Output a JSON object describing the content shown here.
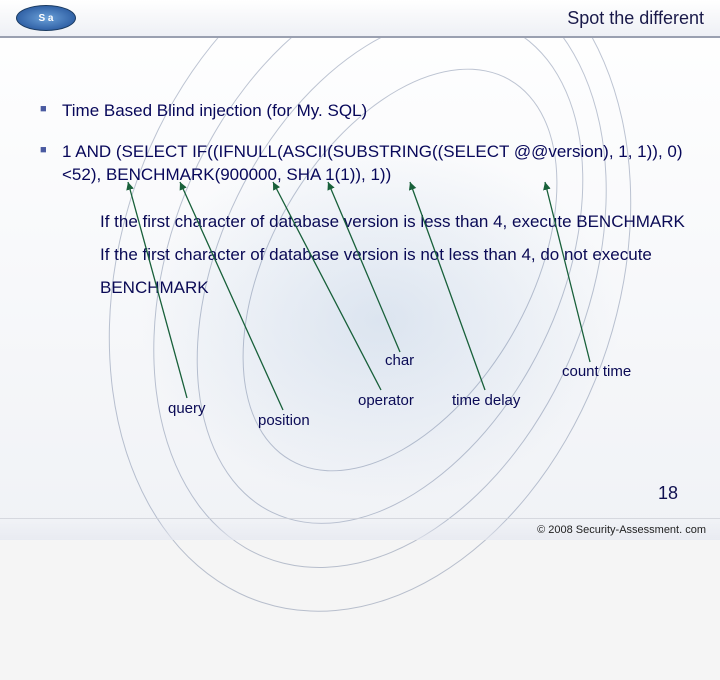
{
  "header": {
    "logo_text": "S a",
    "title": "Spot the different"
  },
  "bullets": [
    "Time Based Blind injection (for My. SQL)",
    "1 AND (SELECT IF((IFNULL(ASCII(SUBSTRING((SELECT @@version), 1, 1)), 0)<52), BENCHMARK(900000, SHA 1(1)), 1))"
  ],
  "explanation": "If the first character of database version is less than 4, execute BENCHMARK If the first character of database version is not less than 4, do not execute BENCHMARK",
  "labels": {
    "char": "char",
    "count_time": "count time",
    "query": "query",
    "position": "position",
    "operator": "operator",
    "time_delay": "time delay"
  },
  "slide_number": "18",
  "copyright": "© 2008 Security-Assessment. com"
}
